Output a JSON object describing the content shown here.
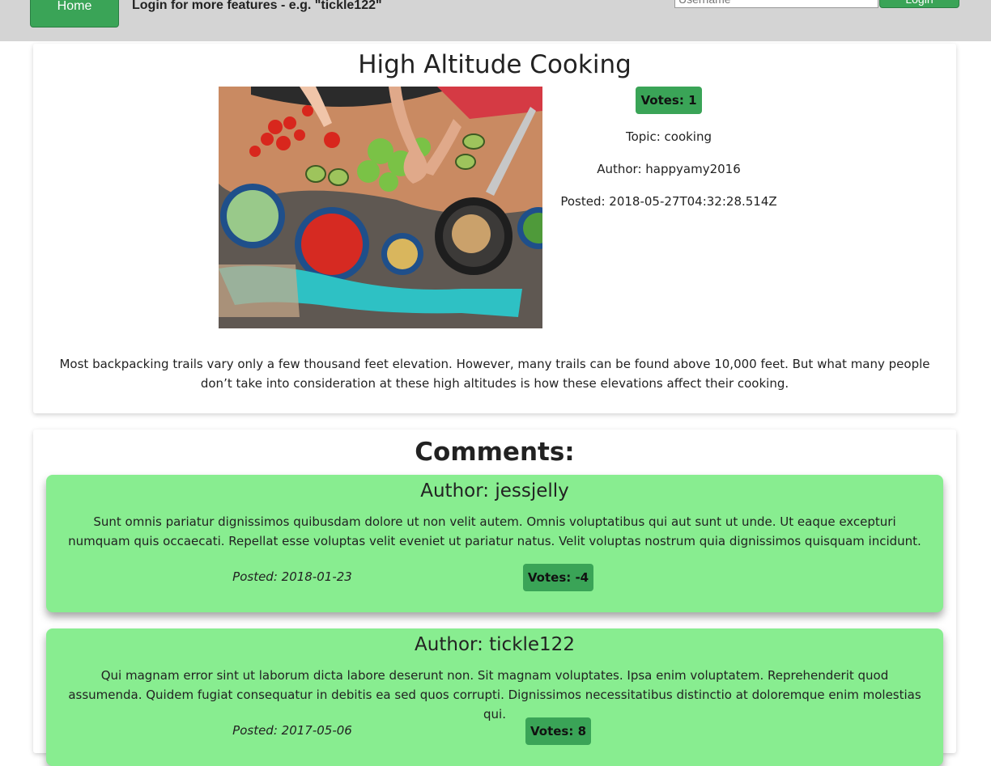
{
  "header": {
    "home_label": "Home",
    "login_hint": "Login for more features - e.g. \"tickle122\"",
    "username_placeholder": "Username",
    "login_label": "Login"
  },
  "article": {
    "title": "High Altitude Cooking",
    "votes": "Votes: 1",
    "topic": "Topic: cooking",
    "author": "Author: happyamy2016",
    "posted": "Posted: 2018-05-27T04:32:28.514Z",
    "body": "Most backpacking trails vary only a few thousand feet elevation. However, many trails can be found above 10,000 feet. But what many people don’t take into consideration at these high altitudes is how these elevations affect their cooking."
  },
  "comments": {
    "heading": "Comments:",
    "items": [
      {
        "author": "Author: jessjelly",
        "body": "Sunt omnis pariatur dignissimos quibusdam dolore ut non velit autem. Omnis voluptatibus qui aut sunt ut unde. Ut eaque excepturi numquam quis occaecati. Repellat esse voluptas velit eveniet ut pariatur natus. Velit voluptas nostrum quia dignissimos quisquam incidunt.",
        "posted": "Posted: 2018-01-23",
        "votes": "Votes: -4"
      },
      {
        "author": "Author: tickle122",
        "body": "Qui magnam error sint ut laborum dicta labore deserunt non. Sit magnam voluptates. Ipsa enim voluptatem. Reprehenderit quod assumenda. Quidem fugiat consequatur in debitis ea sed quos corrupti. Dignissimos necessitatibus distinctio at doloremque enim molestias qui.",
        "posted": "Posted: 2017-05-06",
        "votes": "Votes: 8"
      }
    ]
  },
  "colors": {
    "header_bg": "#d4d4d4",
    "accent_green": "#3aa457",
    "comment_bg": "#88ed90"
  },
  "icons": [
    "cooking-photo"
  ]
}
